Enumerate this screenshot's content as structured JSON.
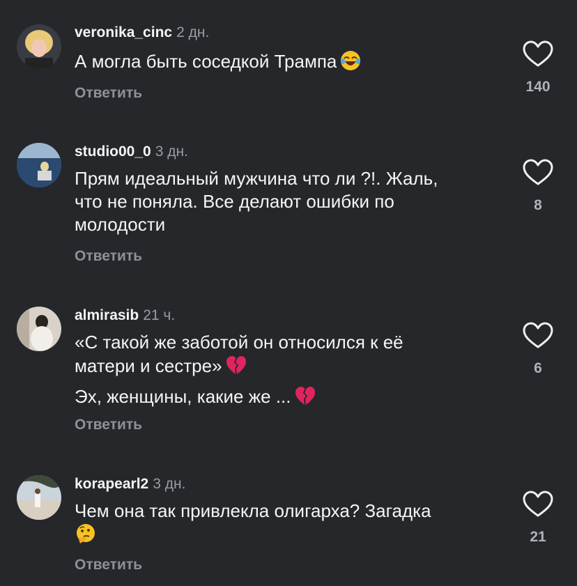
{
  "comments": [
    {
      "username": "veronika_cinc",
      "time": "2 дн.",
      "text_lines": [
        "А могла быть соседкой Трампа"
      ],
      "emoji": "face-with-tears-of-joy-icon",
      "reply_label": "Ответить",
      "likes": "140"
    },
    {
      "username": "studio00_0",
      "time": "3 дн.",
      "text_lines": [
        "Прям идеальный мужчина что ли ?!. Жаль,",
        "что не поняла. Все делают ошибки по",
        "молодости"
      ],
      "reply_label": "Ответить",
      "likes": "8"
    },
    {
      "username": "almirasib",
      "time": "21 ч.",
      "text_lines": [
        "«С такой же заботой он относился к её",
        "матери и сестре»"
      ],
      "text_line_2": "Эх, женщины, какие же ...",
      "emoji": "broken-heart-icon",
      "reply_label": "Ответить",
      "likes": "6"
    },
    {
      "username": "korapearl2",
      "time": "3 дн.",
      "text_lines": [
        "Чем она так привлекла олигарха? Загадка"
      ],
      "emoji": "thinking-face-icon",
      "reply_label": "Ответить",
      "likes": "21"
    }
  ],
  "colors": {
    "background": "#25272b",
    "primary_text": "#f5f5f5",
    "secondary_text": "#9a9ca2",
    "broken_heart": "#e0245e"
  }
}
